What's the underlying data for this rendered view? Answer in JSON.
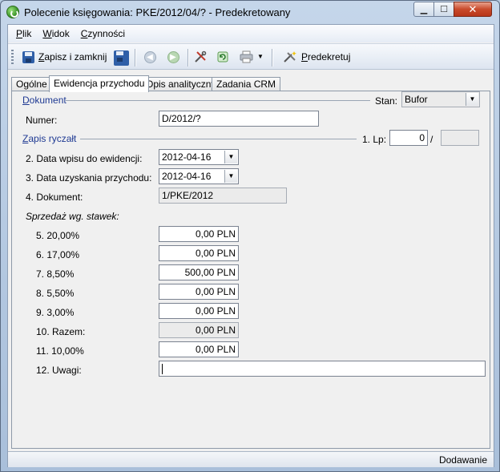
{
  "window": {
    "title": "Polecenie księgowania: PKE/2012/04/? - Predekretowany",
    "min_glyph": "▁",
    "max_glyph": "☐",
    "close_glyph": "✕"
  },
  "menu": [
    "Plik",
    "Widok",
    "Czynności"
  ],
  "toolbar": {
    "save_close_label": "Zapisz i zamknij",
    "predekretuj_label": "Predekretuj",
    "print_dropdown_glyph": "▼",
    "back_glyph": "◀",
    "forward_glyph": "▶"
  },
  "tabs": [
    "Ogólne",
    "Ewidencja przychodu",
    "Opis analityczny",
    "Zadania CRM"
  ],
  "dokument": {
    "section_label": "Dokument",
    "stan_label": "Stan:",
    "stan_value": "Bufor",
    "numer_label": "Numer:",
    "numer_value": "D/2012/?"
  },
  "zapis": {
    "section_label": "Zapis ryczałt",
    "lp_label": "1. Lp:",
    "lp_value": "0",
    "lp_sep": "/",
    "lp_total": "",
    "data_wpisu_label": "2. Data wpisu do ewidencji:",
    "data_wpisu_value": "2012-04-16",
    "data_uzyskania_label": "3. Data uzyskania przychodu:",
    "data_uzyskania_value": "2012-04-16",
    "dokument_label": "4. Dokument:",
    "dokument_value": "1/PKE/2012",
    "sprzedaz_label": "Sprzedaż wg. stawek:",
    "rates": [
      {
        "label": "5.  20,00%",
        "value": "0,00 PLN"
      },
      {
        "label": "6.  17,00%",
        "value": "0,00 PLN"
      },
      {
        "label": "7.  8,50%",
        "value": "500,00 PLN"
      },
      {
        "label": "8.  5,50%",
        "value": "0,00 PLN"
      },
      {
        "label": "9.  3,00%",
        "value": "0,00 PLN"
      },
      {
        "label": "10. Razem:",
        "value": "0,00 PLN"
      },
      {
        "label": "11. 10,00%",
        "value": "0,00 PLN"
      }
    ],
    "uwagi_label": "12. Uwagi:",
    "uwagi_value": ""
  },
  "status": {
    "text": "Dodawanie"
  }
}
